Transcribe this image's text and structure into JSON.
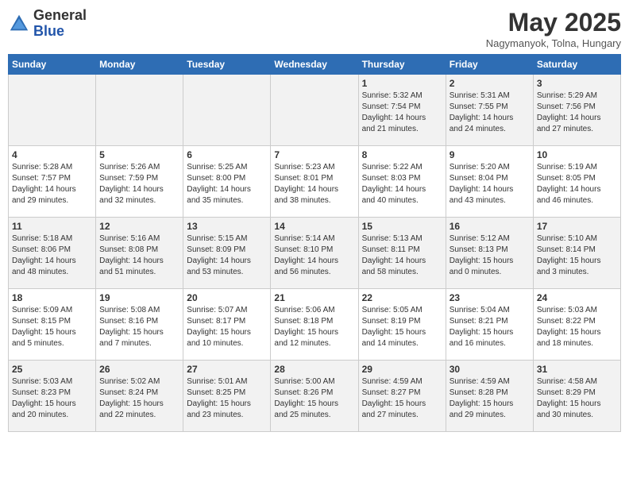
{
  "header": {
    "logo_general": "General",
    "logo_blue": "Blue",
    "month_title": "May 2025",
    "location": "Nagymanyok, Tolna, Hungary"
  },
  "columns": [
    "Sunday",
    "Monday",
    "Tuesday",
    "Wednesday",
    "Thursday",
    "Friday",
    "Saturday"
  ],
  "weeks": [
    [
      {
        "day": "",
        "info": ""
      },
      {
        "day": "",
        "info": ""
      },
      {
        "day": "",
        "info": ""
      },
      {
        "day": "",
        "info": ""
      },
      {
        "day": "1",
        "info": "Sunrise: 5:32 AM\nSunset: 7:54 PM\nDaylight: 14 hours\nand 21 minutes."
      },
      {
        "day": "2",
        "info": "Sunrise: 5:31 AM\nSunset: 7:55 PM\nDaylight: 14 hours\nand 24 minutes."
      },
      {
        "day": "3",
        "info": "Sunrise: 5:29 AM\nSunset: 7:56 PM\nDaylight: 14 hours\nand 27 minutes."
      }
    ],
    [
      {
        "day": "4",
        "info": "Sunrise: 5:28 AM\nSunset: 7:57 PM\nDaylight: 14 hours\nand 29 minutes."
      },
      {
        "day": "5",
        "info": "Sunrise: 5:26 AM\nSunset: 7:59 PM\nDaylight: 14 hours\nand 32 minutes."
      },
      {
        "day": "6",
        "info": "Sunrise: 5:25 AM\nSunset: 8:00 PM\nDaylight: 14 hours\nand 35 minutes."
      },
      {
        "day": "7",
        "info": "Sunrise: 5:23 AM\nSunset: 8:01 PM\nDaylight: 14 hours\nand 38 minutes."
      },
      {
        "day": "8",
        "info": "Sunrise: 5:22 AM\nSunset: 8:03 PM\nDaylight: 14 hours\nand 40 minutes."
      },
      {
        "day": "9",
        "info": "Sunrise: 5:20 AM\nSunset: 8:04 PM\nDaylight: 14 hours\nand 43 minutes."
      },
      {
        "day": "10",
        "info": "Sunrise: 5:19 AM\nSunset: 8:05 PM\nDaylight: 14 hours\nand 46 minutes."
      }
    ],
    [
      {
        "day": "11",
        "info": "Sunrise: 5:18 AM\nSunset: 8:06 PM\nDaylight: 14 hours\nand 48 minutes."
      },
      {
        "day": "12",
        "info": "Sunrise: 5:16 AM\nSunset: 8:08 PM\nDaylight: 14 hours\nand 51 minutes."
      },
      {
        "day": "13",
        "info": "Sunrise: 5:15 AM\nSunset: 8:09 PM\nDaylight: 14 hours\nand 53 minutes."
      },
      {
        "day": "14",
        "info": "Sunrise: 5:14 AM\nSunset: 8:10 PM\nDaylight: 14 hours\nand 56 minutes."
      },
      {
        "day": "15",
        "info": "Sunrise: 5:13 AM\nSunset: 8:11 PM\nDaylight: 14 hours\nand 58 minutes."
      },
      {
        "day": "16",
        "info": "Sunrise: 5:12 AM\nSunset: 8:13 PM\nDaylight: 15 hours\nand 0 minutes."
      },
      {
        "day": "17",
        "info": "Sunrise: 5:10 AM\nSunset: 8:14 PM\nDaylight: 15 hours\nand 3 minutes."
      }
    ],
    [
      {
        "day": "18",
        "info": "Sunrise: 5:09 AM\nSunset: 8:15 PM\nDaylight: 15 hours\nand 5 minutes."
      },
      {
        "day": "19",
        "info": "Sunrise: 5:08 AM\nSunset: 8:16 PM\nDaylight: 15 hours\nand 7 minutes."
      },
      {
        "day": "20",
        "info": "Sunrise: 5:07 AM\nSunset: 8:17 PM\nDaylight: 15 hours\nand 10 minutes."
      },
      {
        "day": "21",
        "info": "Sunrise: 5:06 AM\nSunset: 8:18 PM\nDaylight: 15 hours\nand 12 minutes."
      },
      {
        "day": "22",
        "info": "Sunrise: 5:05 AM\nSunset: 8:19 PM\nDaylight: 15 hours\nand 14 minutes."
      },
      {
        "day": "23",
        "info": "Sunrise: 5:04 AM\nSunset: 8:21 PM\nDaylight: 15 hours\nand 16 minutes."
      },
      {
        "day": "24",
        "info": "Sunrise: 5:03 AM\nSunset: 8:22 PM\nDaylight: 15 hours\nand 18 minutes."
      }
    ],
    [
      {
        "day": "25",
        "info": "Sunrise: 5:03 AM\nSunset: 8:23 PM\nDaylight: 15 hours\nand 20 minutes."
      },
      {
        "day": "26",
        "info": "Sunrise: 5:02 AM\nSunset: 8:24 PM\nDaylight: 15 hours\nand 22 minutes."
      },
      {
        "day": "27",
        "info": "Sunrise: 5:01 AM\nSunset: 8:25 PM\nDaylight: 15 hours\nand 23 minutes."
      },
      {
        "day": "28",
        "info": "Sunrise: 5:00 AM\nSunset: 8:26 PM\nDaylight: 15 hours\nand 25 minutes."
      },
      {
        "day": "29",
        "info": "Sunrise: 4:59 AM\nSunset: 8:27 PM\nDaylight: 15 hours\nand 27 minutes."
      },
      {
        "day": "30",
        "info": "Sunrise: 4:59 AM\nSunset: 8:28 PM\nDaylight: 15 hours\nand 29 minutes."
      },
      {
        "day": "31",
        "info": "Sunrise: 4:58 AM\nSunset: 8:29 PM\nDaylight: 15 hours\nand 30 minutes."
      }
    ]
  ]
}
